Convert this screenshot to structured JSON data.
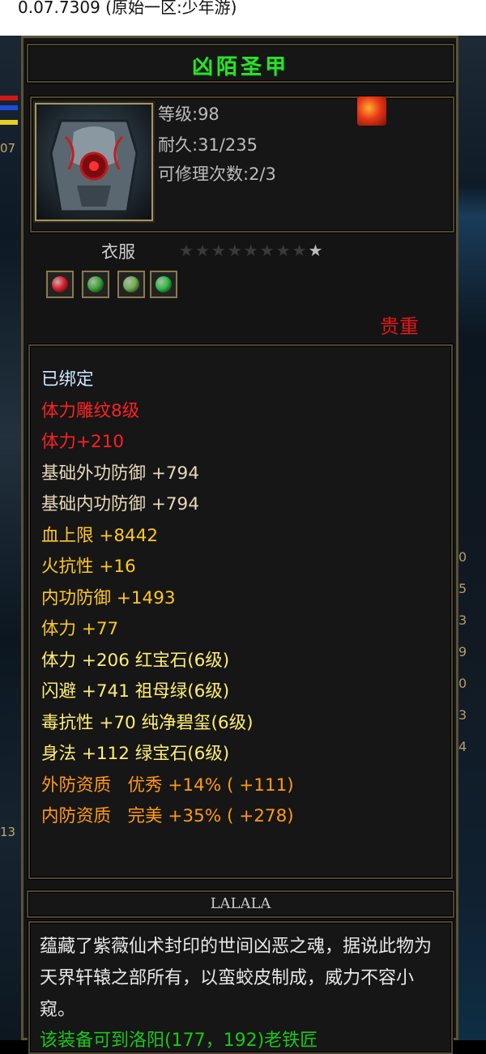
{
  "window": {
    "title": "0.07.7309 (原始一区:少年游)"
  },
  "side": {
    "left_values": [
      "07",
      "13"
    ],
    "right_values": [
      "0",
      "5",
      "3",
      "9",
      "0",
      "3",
      "4"
    ]
  },
  "item": {
    "name": "凶陌圣甲",
    "level": "等级:98",
    "durability": "耐久:31/235",
    "repairs": "可修理次数:2/3",
    "category": "衣服",
    "stars_total": 9,
    "stars_lit": 1,
    "rarity": "贵重",
    "rarity_color": "#e01818",
    "gems": [
      {
        "name": "ruby-gem",
        "color": "#e0202a"
      },
      {
        "name": "emerald-gem",
        "color": "#3aa838"
      },
      {
        "name": "jade-gem",
        "color": "#6fb04a"
      },
      {
        "name": "green-gem",
        "color": "#2cc040"
      }
    ]
  },
  "attributes": [
    {
      "text": "已绑定",
      "color": "#cfe8ff"
    },
    {
      "text": "体力雕纹8级",
      "color": "#ff2020"
    },
    {
      "text": "体力+210",
      "color": "#ff2020"
    },
    {
      "text": "基础外功防御 +794",
      "color": "#e8d8b8"
    },
    {
      "text": "基础内功防御 +794",
      "color": "#e8d8b8"
    },
    {
      "text": "血上限 +8442",
      "color": "#ffc820"
    },
    {
      "text": "火抗性 +16",
      "color": "#ffc820"
    },
    {
      "text": "内功防御 +1493",
      "color": "#ffc820"
    },
    {
      "text": "体力 +77",
      "color": "#ffc820"
    },
    {
      "text": "体力 +206 红宝石(6级)",
      "color": "#ffef70"
    },
    {
      "text": "闪避 +741 祖母绿(6级)",
      "color": "#ffef70"
    },
    {
      "text": "毒抗性 +70 纯净碧玺(6级)",
      "color": "#ffef70"
    },
    {
      "text": "身法 +112 绿宝石(6级)",
      "color": "#ffef70"
    },
    {
      "text": "外防资质   优秀 +14% ( +111)",
      "color": "#ff9a14"
    },
    {
      "text": "内防资质   完美 +35% ( +278)",
      "color": "#ff9a14"
    }
  ],
  "owner": "LALALA",
  "description": "蕴藏了紫薇仙术封印的世间凶恶之魂，据说此物为天界轩辕之部所有，以蛮蛟皮制成，威力不容小窥。",
  "description_extra": "该装备可到洛阳(177，192)老铁匠"
}
